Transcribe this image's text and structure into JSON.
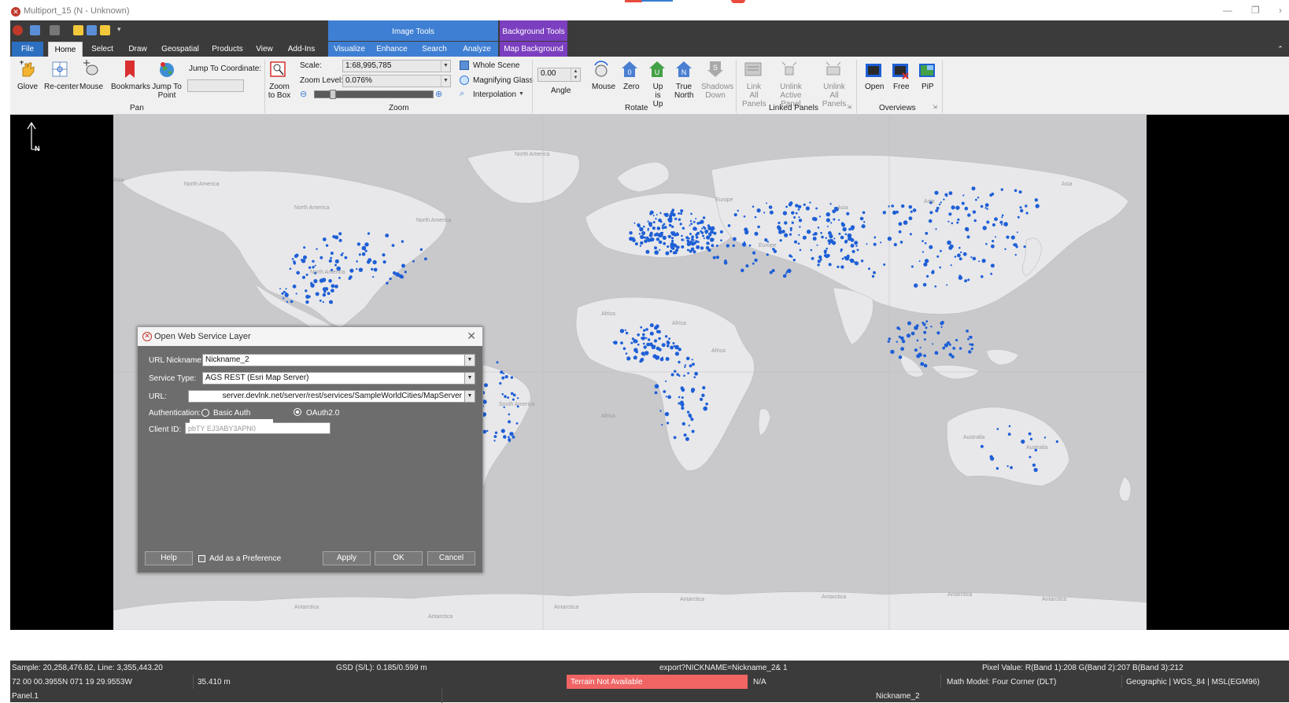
{
  "window": {
    "title": "Multiport_15 (N - Unknown)"
  },
  "ribbon": {
    "contextual_groups": {
      "image_tools": "Image Tools",
      "background_tools": "Background Tools"
    },
    "tabs": [
      "File",
      "Home",
      "Select",
      "Draw",
      "Geospatial",
      "Products",
      "View",
      "Add-Ins",
      "Visualize",
      "Enhance",
      "Search",
      "Analyze",
      "Map Background"
    ],
    "pan": {
      "group_label": "Pan",
      "glove": "Glove",
      "recenter": "Re-center",
      "mouse": "Mouse",
      "bookmarks": "Bookmarks",
      "jump_to_point": "Jump To Point",
      "jump_to_coordinate": "Jump To Coordinate:"
    },
    "zoom": {
      "group_label": "Zoom",
      "zoom_to_box": "Zoom to Box",
      "scale_label": "Scale:",
      "scale_value": "1:68,995,785",
      "zoom_level_label": "Zoom Level:",
      "zoom_level_value": "0.076%",
      "whole_scene": "Whole Scene",
      "magnifying_glass": "Magnifying Glass",
      "interpolation": "Interpolation"
    },
    "rotate": {
      "group_label": "Rotate",
      "angle_value": "0.00",
      "angle_label": "Angle",
      "mouse": "Mouse",
      "zero": "Zero",
      "up_is_up": "Up is Up",
      "true_north": "True North",
      "shadows_down": "Shadows Down"
    },
    "linked_panels": {
      "group_label": "Linked Panels",
      "link_all": "Link All Panels",
      "unlink_active": "Unlink Active Panel",
      "unlink_all": "Unlink All Panels"
    },
    "overviews": {
      "group_label": "Overviews",
      "open": "Open",
      "free": "Free",
      "pip": "PiP"
    }
  },
  "map": {
    "labels": [
      "North America",
      "North America",
      "North America",
      "North America",
      "North America",
      "Asia",
      "Asia",
      "Asia",
      "Asia",
      "Europe",
      "Europe",
      "Africa",
      "Africa",
      "Africa",
      "Africa",
      "South America",
      "Australia",
      "Australia",
      "Antarctica",
      "Antarctica",
      "Antarctica",
      "Antarctica",
      "Antarctica",
      "Antarctica",
      "Antarctica"
    ],
    "north_label": "N",
    "colors": {
      "land": "#e8e8ea",
      "ocean": "#c9c9cc",
      "city": "#1e5fd6"
    }
  },
  "dialog": {
    "title": "Open Web Service Layer",
    "url_nickname_label": "URL Nickname:",
    "url_nickname_value": "Nickname_2",
    "service_type_label": "Service Type:",
    "service_type_value": "AGS REST (Esri Map Server)",
    "url_label": "URL:",
    "url_value": "server.devlnk.net/server/rest/services/SampleWorldCities/MapServer",
    "authentication_label": "Authentication:",
    "basic_auth": "Basic Auth",
    "oauth": "OAuth2.0",
    "client_id_label": "Client ID:",
    "client_id_value": "pbTY EJ3ABY3APN0",
    "help": "Help",
    "add_preference": "Add as a Preference",
    "apply": "Apply",
    "ok": "OK",
    "cancel": "Cancel"
  },
  "status": {
    "sample": "Sample: 20,258,476.82, Line: 3,355,443.20",
    "gsd": "GSD (S/L): 0.185/0.599 m",
    "export": "export?NICKNAME=Nickname_2& 1",
    "pixel_value": "Pixel Value: R(Band 1):208 G(Band 2):207 B(Band 3):212",
    "coords": "72 00 00.3955N 071 19 29.9553W",
    "elevation": "35.410 m",
    "terrain": "Terrain Not Available",
    "na": "N/A",
    "math_model": "Math Model: Four Corner (DLT)",
    "geographic": "Geographic | WGS_84 | MSL(EGM96)",
    "panel": "Panel.1",
    "nickname": "Nickname_2"
  }
}
